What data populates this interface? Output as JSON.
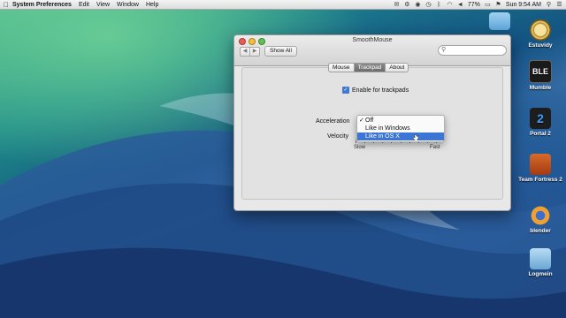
{
  "menubar": {
    "app_name": "System Preferences",
    "menus": [
      "Edit",
      "View",
      "Window",
      "Help"
    ],
    "battery": "77%",
    "clock": "Sun 9:54 AM"
  },
  "desktop_icons": [
    {
      "label": "Estuvidy",
      "icon": "clock-icon"
    },
    {
      "label": "Mumble",
      "icon": "mumble-icon"
    },
    {
      "label": "Portal 2",
      "icon": "portal2-icon"
    },
    {
      "label": "Team Fortress 2",
      "icon": "tf2-icon"
    },
    {
      "label": "blender",
      "icon": "blender-icon"
    },
    {
      "label": "Logmein",
      "icon": "folder-icon"
    }
  ],
  "window": {
    "title": "SmoothMouse",
    "show_all": "Show All",
    "search_placeholder": "",
    "tabs": [
      {
        "label": "Mouse",
        "active": false
      },
      {
        "label": "Trackpad",
        "active": true
      },
      {
        "label": "About",
        "active": false
      }
    ],
    "enable_label": "Enable for trackpads",
    "enable_checked": true,
    "acceleration_label": "Acceleration",
    "velocity_label": "Velocity",
    "slow_label": "Slow",
    "fast_label": "Fast",
    "dropdown": {
      "options": [
        {
          "label": "Off",
          "checked": true
        },
        {
          "label": "Like in Windows",
          "checked": false
        },
        {
          "label": "Like in OS X",
          "checked": false,
          "highlighted": true
        }
      ]
    }
  },
  "colors": {
    "highlight": "#3b76d7",
    "menubar": "#e6e6e6"
  }
}
